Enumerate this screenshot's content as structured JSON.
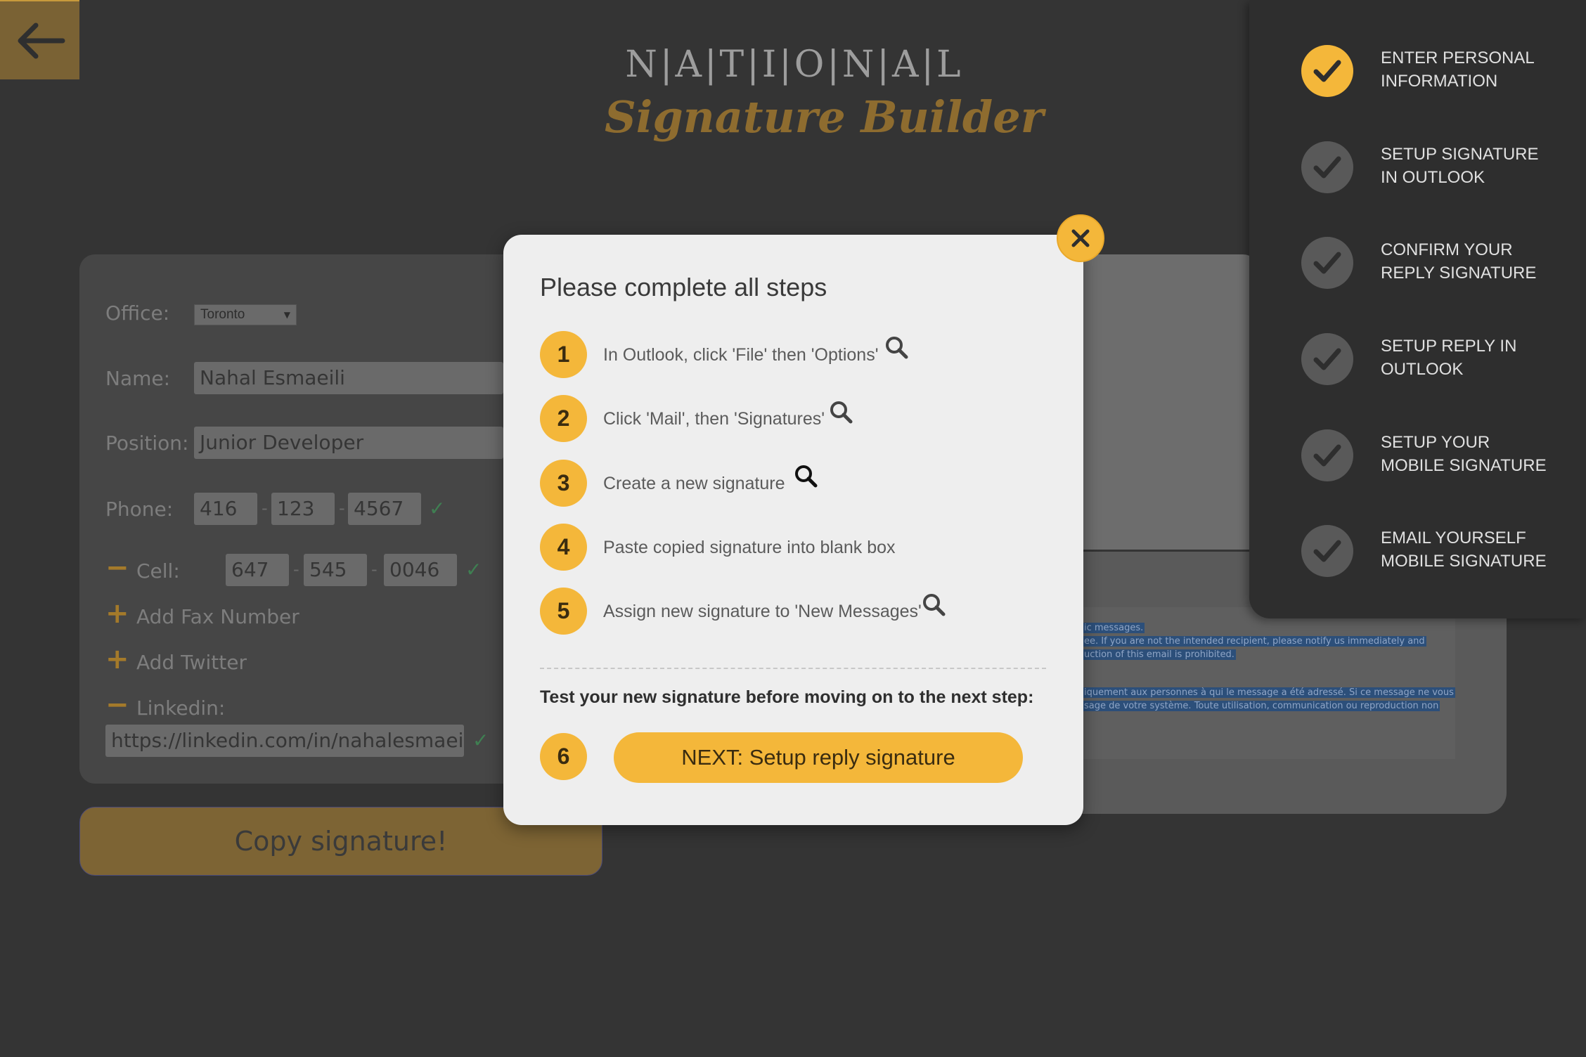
{
  "header": {
    "brand_top": "N|A|T|I|O|N|A|L",
    "brand_bottom": "Signature Builder"
  },
  "icons": {
    "back": "arrow-left-icon",
    "close": "close-icon",
    "search": "search-icon",
    "check": "check-icon"
  },
  "colors": {
    "accent": "#f4b73a",
    "background": "#343434",
    "modal_bg": "#eeeeee",
    "sidebar_bg": "#2e2e2e",
    "check_mark": "#3f7f52"
  },
  "form": {
    "office_label": "Office:",
    "office_value": "Toronto",
    "name_label": "Name:",
    "name_value": "Nahal Esmaeili",
    "position_label": "Position:",
    "position_value": "Junior Developer",
    "phone_label": "Phone:",
    "phone": [
      "416",
      "123",
      "4567"
    ],
    "cell_label": "Cell:",
    "cell": [
      "647",
      "545",
      "0046"
    ],
    "add_fax": "Add Fax Number",
    "add_twitter": "Add Twitter",
    "linkedin_label": "Linkedin:",
    "linkedin_value": "https://linkedin.com/in/nahalesmaeili",
    "minus": "−",
    "plus": "+",
    "dash": "-",
    "check": "✓",
    "copy_button": "Copy signature!"
  },
  "preview": {
    "lines_en": [
      "ic messages.",
      "ee. If you are not the intended recipient, please notify us immediately and",
      "uction of this email is prohibited."
    ],
    "lines_fr": [
      "iquement aux personnes à qui le message a été adressé. Si ce message ne vous",
      "sage de votre système. Toute utilisation, communication ou reproduction non"
    ]
  },
  "sidebar": {
    "steps": [
      {
        "label_line1": "ENTER PERSONAL",
        "label_line2": "INFORMATION",
        "done": true
      },
      {
        "label_line1": "SETUP SIGNATURE",
        "label_line2": "IN OUTLOOK",
        "done": false
      },
      {
        "label_line1": "CONFIRM YOUR",
        "label_line2": "REPLY SIGNATURE",
        "done": false
      },
      {
        "label_line1": "SETUP REPLY IN",
        "label_line2": "OUTLOOK",
        "done": false
      },
      {
        "label_line1": "SETUP YOUR",
        "label_line2": "MOBILE SIGNATURE",
        "done": false
      },
      {
        "label_line1": "EMAIL YOURSELF",
        "label_line2": "MOBILE SIGNATURE",
        "done": false
      }
    ]
  },
  "modal": {
    "title": "Please complete all steps",
    "steps": [
      {
        "num": "1",
        "text": "In Outlook, click 'File' then 'Options'",
        "has_search": true
      },
      {
        "num": "2",
        "text": "Click 'Mail', then 'Signatures'",
        "has_search": true
      },
      {
        "num": "3",
        "text": "Create a new signature",
        "has_search": true
      },
      {
        "num": "4",
        "text": "Paste copied signature into blank box",
        "has_search": false
      },
      {
        "num": "5",
        "text": "Assign new signature to 'New Messages'",
        "has_search": true
      }
    ],
    "test_text": "Test your new signature before moving on to the next step:",
    "step6_num": "6",
    "next_button": "NEXT: Setup reply signature"
  }
}
